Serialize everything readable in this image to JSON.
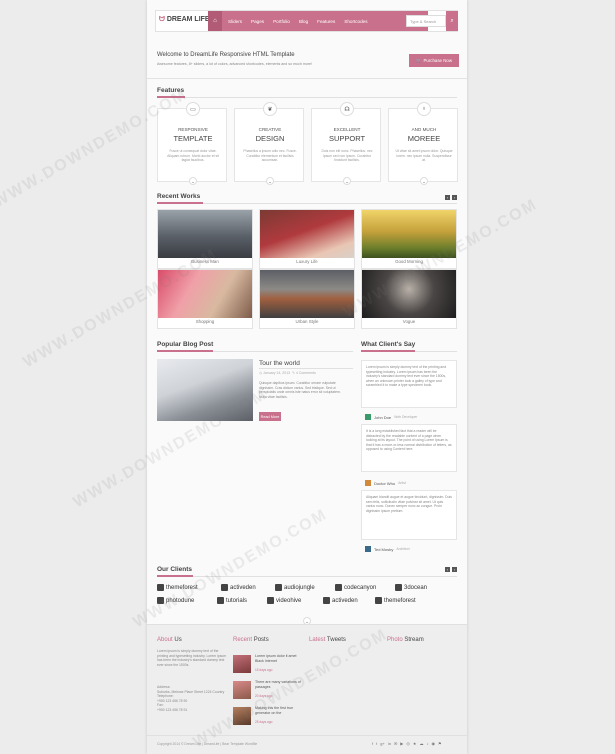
{
  "header": {
    "logo": "DREAM LIFE",
    "nav": [
      "Sliders",
      "Pages",
      "Portfolio",
      "Blog",
      "Features",
      "Shortcodes"
    ],
    "search_placeholder": "Type & Search"
  },
  "welcome": {
    "title": "Welcome to DreamLife Responsive HTML Template",
    "subtitle": "Awesome features, 8+ sliders, a lot of colors, advanced shortcodes, elements and so much more!",
    "button": "Purchase Now"
  },
  "features": {
    "heading": "Features",
    "items": [
      {
        "t1": "RESPONSIVE",
        "t2": "TEMPLATE",
        "icon": "monitor-icon",
        "glyph": "▭",
        "desc": "Fusce ut consequat dolor vitae. Aliquam rutrum. Morbi auctor et sit fagiat faucibus."
      },
      {
        "t1": "CREATIVE",
        "t2": "DESIGN",
        "icon": "leaf-icon",
        "glyph": "❦",
        "desc": "Phasellus a ipsum odio nec. Fusce. Curabitur elementum et facilisis accumsan."
      },
      {
        "t1": "EXCELLENT",
        "t2": "SUPPORT",
        "icon": "headset-icon",
        "glyph": "☊",
        "desc": "Duis non elit nunc. Phasellus. nec ipsum sed non ipsum. Curabitur tincidunt facilisis."
      },
      {
        "t1": "AND MUCH",
        "t2": "MOREEE",
        "icon": "lightbulb-icon",
        "glyph": "♁",
        "desc": "Ut vitae sit amet ipsum dolor. Quisque lorem. nec ipsum nulla. Suspendisse at."
      }
    ]
  },
  "works": {
    "heading": "Recent Works",
    "items": [
      {
        "caption": "Business Man"
      },
      {
        "caption": "Luxury Life"
      },
      {
        "caption": "Good Morning"
      },
      {
        "caption": "Shopping"
      },
      {
        "caption": "Urban Style"
      },
      {
        "caption": "Vogue"
      }
    ]
  },
  "blog": {
    "heading": "Popular Blog Post",
    "title": "Tour the world",
    "date": "January 14, 2013",
    "comments": "4 Comments",
    "text": "Quisque dapibus ipsum. Curabitur ornare vulputate dignissim. Cras dictum varius. Sed tristique. Sed ut perspiciatis unde omnis iste natus error sit voluptatem. Nulla vitae facilisis.",
    "button": "Read More"
  },
  "testimonials": {
    "heading": "What Client's Say",
    "items": [
      {
        "text": "Lorem ipsum is simply dummy text of the printing and typesetting industry. Lorem ipsum has been the industry's standard dummy text ever since the 1500s, when an unknown printer took a galley of type and scrambled it to make a type specimen book.",
        "name": "John Doe",
        "role": "Web Developer"
      },
      {
        "text": "It is a long established fact that a reader will be distracted by the readable content of a page when looking at its layout. The point of using Lorem Ipsum is that it has a more-or-less normal distribution of letters, as opposed to using Content here.",
        "name": "Doctor Who",
        "role": "Artist"
      },
      {
        "text": "Aliquam blandit augue et augue tincidunt, dignissim. Duis sem felis, sollicitudin vitae pulvinar sit amet. Ut quis varius nunc. Donec semper nunc ac congue. Proin dignissim ipsum pretium.",
        "name": "Ted Mosby",
        "role": "Architect"
      }
    ]
  },
  "clients": {
    "heading": "Our Clients",
    "items": [
      "themeforest",
      "activeden",
      "audiojungle",
      "codecanyon",
      "3docean",
      "photodune",
      "tutorials",
      "videohive",
      "activeden",
      "themeforest"
    ]
  },
  "footer": {
    "about": {
      "h1": "About",
      "h2": "Us",
      "text": "Lorem ipsum is simply dummy text of the printing and typesetting industry. Lorem ipsum has been the industry's standard dummy text ever since the 1500s.",
      "address_label": "Address:",
      "address": "Suburbs, Melrose Place Street 1224 Country",
      "phone_label": "Telephone:",
      "phone": "+950 123 456 78 90",
      "fax_label": "Fax:",
      "fax": "+950 123 456 78 91"
    },
    "recent": {
      "h1": "Recent",
      "h2": "Posts",
      "items": [
        {
          "title": "Lorem ipsum dolor it amet Black Internet",
          "date": "15 days ago",
          "glyph": "♀"
        },
        {
          "title": "There are many variations of passages",
          "date": "20 days ago",
          "glyph": "♀"
        },
        {
          "title": "Making this the first true generator on the",
          "date": "25 days ago",
          "glyph": "♀"
        }
      ]
    },
    "tweets": {
      "h1": "Latest",
      "h2": "Tweets"
    },
    "photos": {
      "h1": "Photo",
      "h2": "Stream"
    },
    "copyright": "Copyright 2014 © Dream Life | DreamLife | Bear Template Wordfile",
    "social": [
      "f",
      "t",
      "g+",
      "in",
      "✉",
      "▶",
      "◎",
      "★",
      "☁",
      "♪",
      "◉",
      "⚑"
    ]
  },
  "watermarks": [
    "WWW.DOWNDEMO.COM",
    "WWW.DOWNDEMO.COM",
    "WWW.DOWNDEMO.COM",
    "WWW.DOWNDEMO.COM",
    "WWW.DOWNDEMO.COM",
    "WWW.DOWNDEMO.COM"
  ],
  "colors": {
    "accent": "#c8708c",
    "background": "#ececec"
  }
}
